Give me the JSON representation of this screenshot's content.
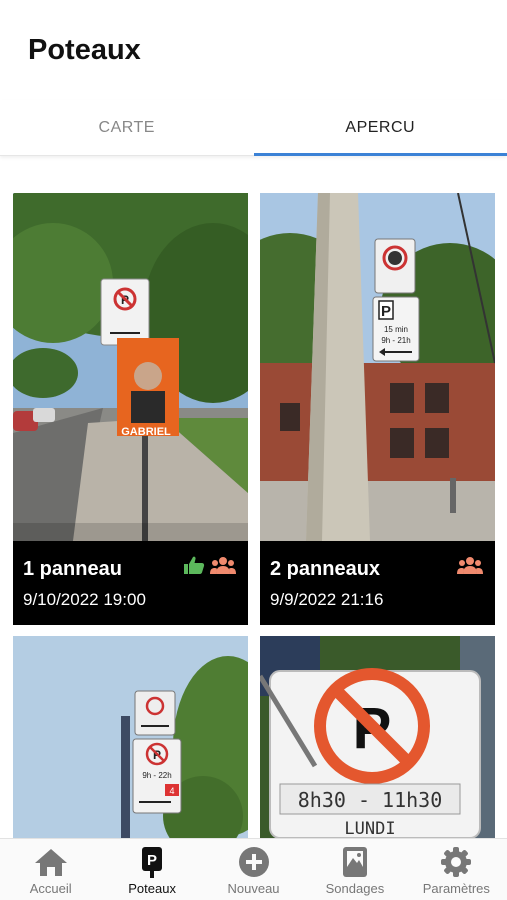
{
  "header": {
    "title": "Poteaux"
  },
  "tabs": [
    {
      "label": "CARTE",
      "active": false
    },
    {
      "label": "APERCU",
      "active": true
    }
  ],
  "cards": [
    {
      "count": "1 panneau",
      "date": "9/10/2022 19:00",
      "icons": [
        "thumbs-up-icon",
        "group-icon"
      ],
      "poster_text": "GABRIEL"
    },
    {
      "count": "2 panneaux",
      "date": "9/9/2022 21:16",
      "icons": [
        "group-icon"
      ],
      "sign_p": "P",
      "sign_line1": "15 min",
      "sign_line2": "9h - 21h"
    },
    {
      "sign_line1": "9h - 22h",
      "sign_badge": "4"
    },
    {
      "sign_p": "P",
      "sign_line1": "8h30 - 11h30",
      "sign_line2": "LUNDI"
    }
  ],
  "navbar": {
    "items": [
      {
        "label": "Accueil",
        "icon": "home-icon",
        "active": false
      },
      {
        "label": "Poteaux",
        "icon": "pole-sign-icon",
        "active": true
      },
      {
        "label": "Nouveau",
        "icon": "add-circle-icon",
        "active": false
      },
      {
        "label": "Sondages",
        "icon": "image-survey-icon",
        "active": false
      },
      {
        "label": "Paramètres",
        "icon": "gear-icon",
        "active": false
      }
    ]
  },
  "colors": {
    "accent": "#3b82d6",
    "thumbs": "#5cb85c",
    "group": "#f08a6e",
    "caption_bg": "#000000"
  }
}
